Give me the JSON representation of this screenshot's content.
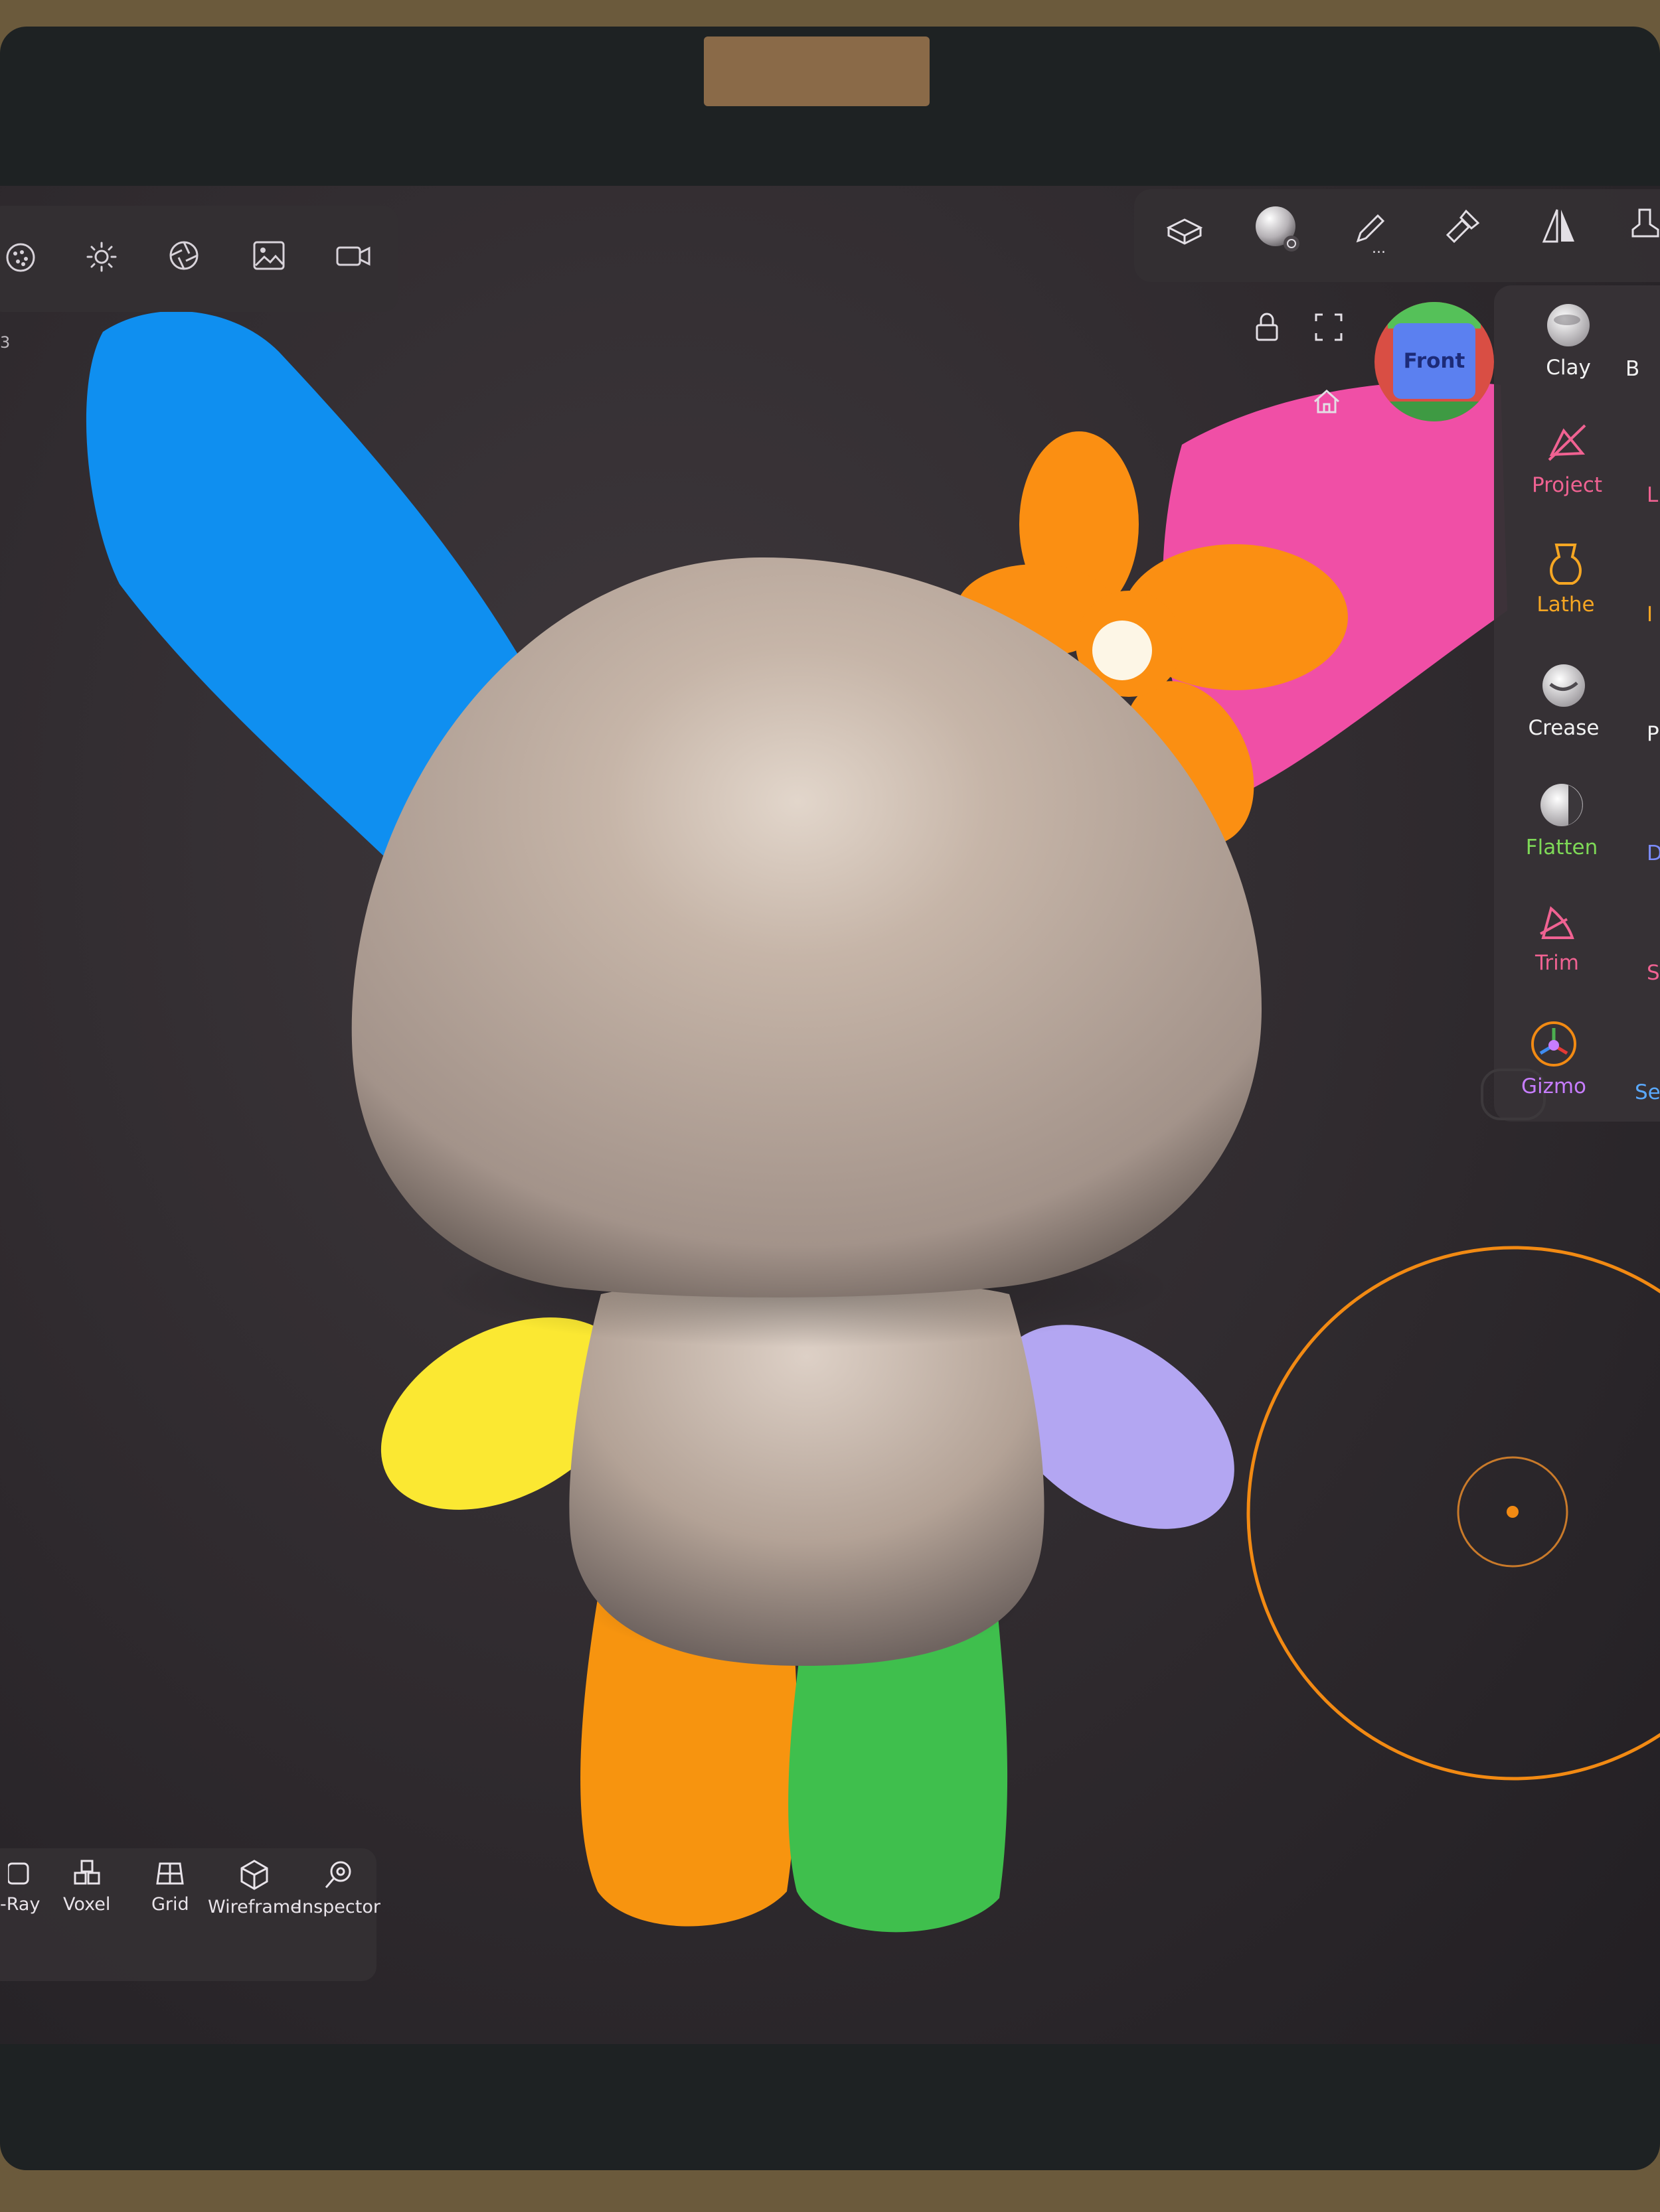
{
  "view_cube": {
    "label": "Front"
  },
  "toolbar_right": {
    "more_indicator": "..."
  },
  "tools": [
    {
      "label": "Clay",
      "color": "#f2f2f2"
    },
    {
      "label": "Project",
      "color": "#f06292"
    },
    {
      "label": "Lathe",
      "color": "#f5a623"
    },
    {
      "label": "Crease",
      "color": "#f2f2f2"
    },
    {
      "label": "Flatten",
      "color": "#7ed957"
    },
    {
      "label": "Trim",
      "color": "#f06292"
    },
    {
      "label": "Gizmo",
      "color": "#c77dff"
    }
  ],
  "tools_second_column": [
    {
      "label": "B"
    },
    {
      "label": "L"
    },
    {
      "label": "I"
    },
    {
      "label": "P"
    },
    {
      "label": "D"
    },
    {
      "label": "S"
    },
    {
      "label": "Se"
    }
  ],
  "render_bar": [
    {
      "label": "-Ray"
    },
    {
      "label": "Voxel"
    },
    {
      "label": "Grid"
    },
    {
      "label": "Wireframe"
    },
    {
      "label": "Inspector"
    }
  ],
  "edge_fragment": "3",
  "colors": {
    "ear_left": "#0f8ff0",
    "ear_right": "#f04fa6",
    "flower": "#fb8f12",
    "arm_left": "#fbe832",
    "arm_right": "#b3a6f2",
    "leg_left": "#f7940f",
    "leg_right": "#3fbf4d",
    "clay": "#bfada0",
    "brush_ring": "#f28a13",
    "panel": "#343033"
  }
}
